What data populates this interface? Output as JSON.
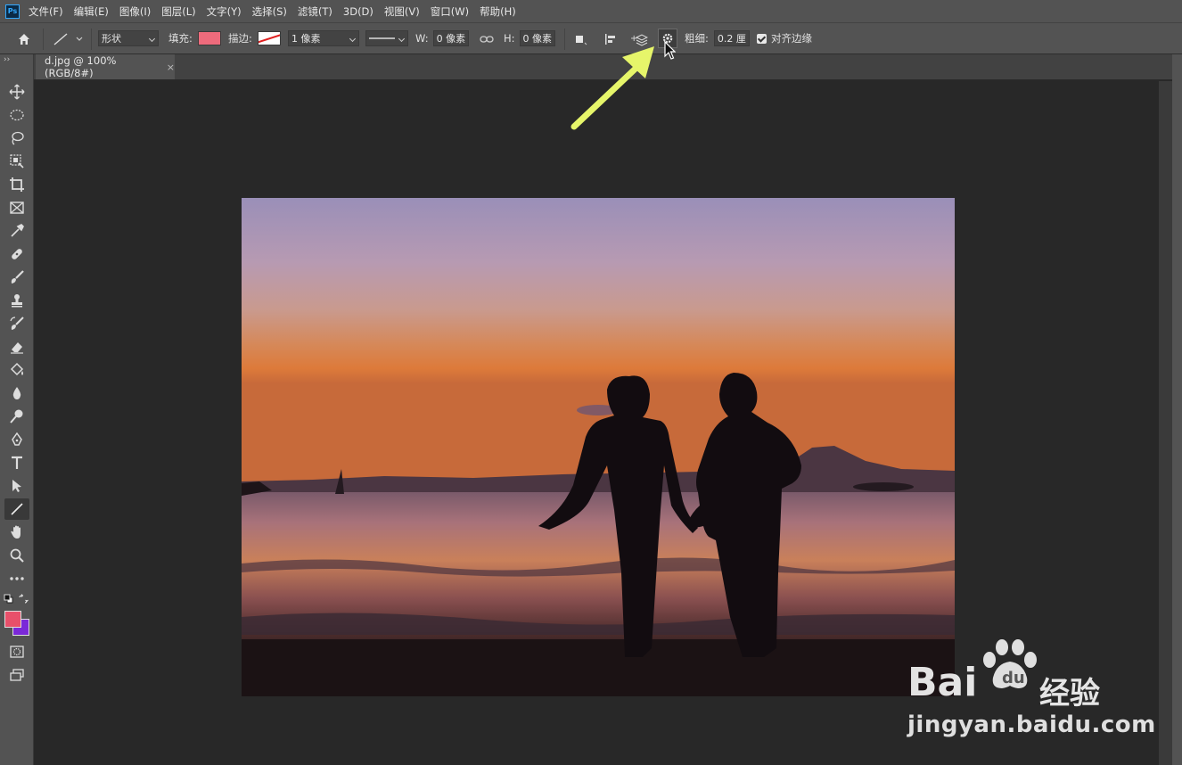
{
  "app": {
    "logo": "Ps"
  },
  "menu": [
    "文件(F)",
    "编辑(E)",
    "图像(I)",
    "图层(L)",
    "文字(Y)",
    "选择(S)",
    "滤镜(T)",
    "3D(D)",
    "视图(V)",
    "窗口(W)",
    "帮助(H)"
  ],
  "options": {
    "mode_value": "形状",
    "fill_label": "填充:",
    "fill_color": "#ee6b7c",
    "stroke_label": "描边:",
    "stroke_width_value": "1 像素",
    "w_label": "W:",
    "w_value": "0 像素",
    "h_label": "H:",
    "h_value": "0 像素",
    "weight_label": "粗细:",
    "weight_value": "0.2 厘",
    "align_edges_label": "对齐边缘",
    "align_edges_checked": true
  },
  "document_tab": {
    "title": "d.jpg @ 100%(RGB/8#)",
    "close": "×"
  },
  "tools": [
    "move-tool",
    "marquee-tool",
    "lasso-tool",
    "object-select-tool",
    "crop-tool",
    "frame-tool",
    "eyedropper-tool",
    "healing-brush-tool",
    "brush-tool",
    "clone-stamp-tool",
    "history-brush-tool",
    "eraser-tool",
    "paint-bucket-tool",
    "blur-tool",
    "dodge-tool",
    "pen-tool",
    "type-tool",
    "path-select-tool",
    "line-tool",
    "hand-tool",
    "zoom-tool",
    "more-tools"
  ],
  "colors": {
    "foreground": "#e8506a",
    "background": "#7b28d8",
    "annotation_arrow": "#e6f56a"
  },
  "watermark": {
    "brand": "Bai",
    "brand_cn": "经验",
    "url": "jingyan.baidu.com"
  }
}
